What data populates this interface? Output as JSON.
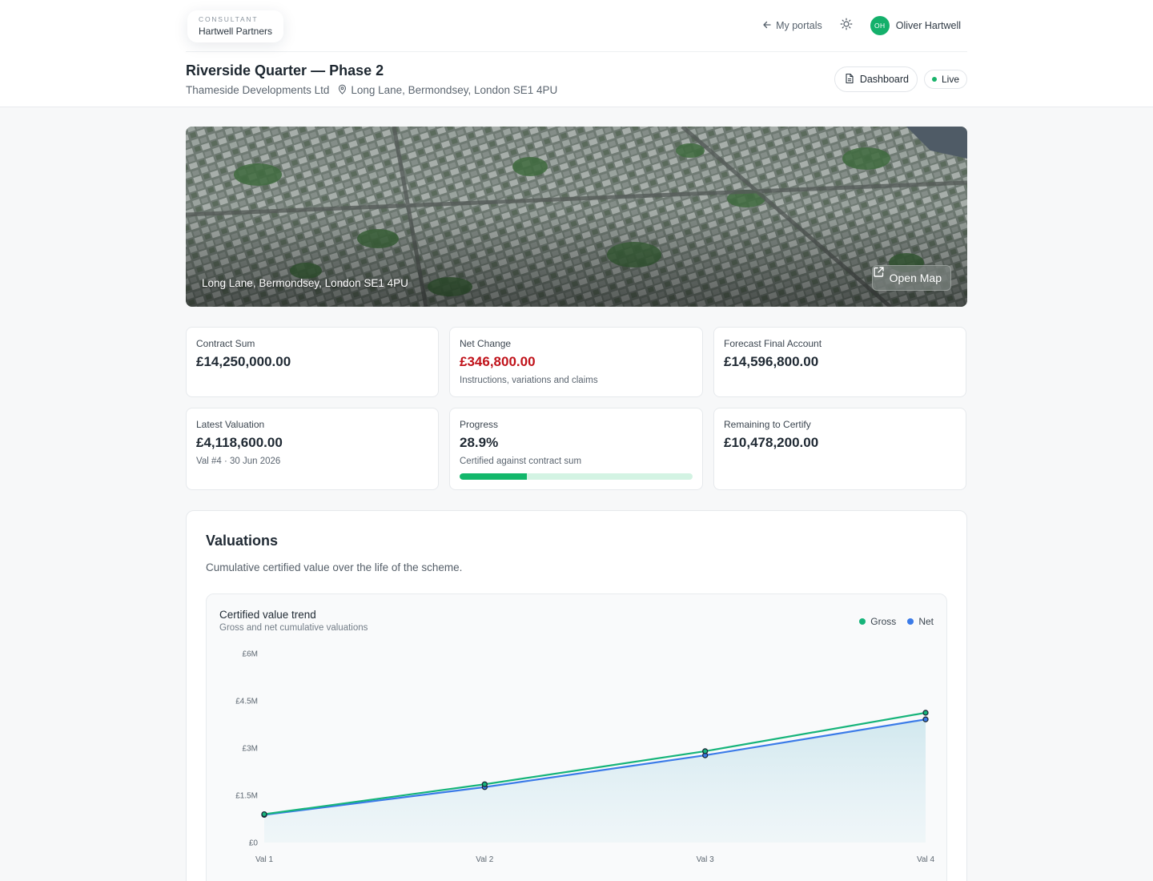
{
  "header": {
    "brand_kicker": "CONSULTANT",
    "brand_name": "Hartwell Partners",
    "portals_label": "My portals",
    "user_initials": "OH",
    "user_name": "Oliver Hartwell"
  },
  "project": {
    "title": "Riverside Quarter — Phase 2",
    "client": "Thameside Developments Ltd",
    "address": "Long Lane, Bermondsey, London SE1 4PU",
    "dashboard_label": "Dashboard",
    "status_label": "Live"
  },
  "hero": {
    "caption": "Long Lane, Bermondsey, London SE1 4PU",
    "open_map_label": "Open Map"
  },
  "cards": {
    "contract_sum": {
      "label": "Contract Sum",
      "value": "£14,250,000.00"
    },
    "net_change": {
      "label": "Net Change",
      "value": "£346,800.00",
      "sub": "Instructions, variations and claims"
    },
    "forecast": {
      "label": "Forecast Final Account",
      "value": "£14,596,800.00"
    },
    "latest_valuation": {
      "label": "Latest Valuation",
      "value": "£4,118,600.00",
      "sub": "Val #4 · 30 Jun 2026"
    },
    "progress": {
      "label": "Progress",
      "value": "28.9%",
      "sub": "Certified against contract sum",
      "fraction": 0.289
    },
    "remaining": {
      "label": "Remaining to Certify",
      "value": "£10,478,200.00"
    }
  },
  "colors": {
    "gross": "#16b47a",
    "net": "#3b7be8",
    "negative": "#c0121a",
    "accent": "#12b76b"
  },
  "valuations": {
    "title": "Valuations",
    "description": "Cumulative certified value over the life of the scheme."
  },
  "chart_data": {
    "type": "line",
    "title": "Certified value trend",
    "subtitle": "Gross and net cumulative valuations",
    "categories": [
      "Val 1",
      "Val 2",
      "Val 3",
      "Val 4"
    ],
    "series": [
      {
        "name": "Gross",
        "values": [
          900000,
          1850000,
          2900000,
          4120000
        ]
      },
      {
        "name": "Net",
        "values": [
          880000,
          1760000,
          2770000,
          3910000
        ]
      }
    ],
    "y_ticks": [
      "£0",
      "£1.5M",
      "£3M",
      "£4.5M",
      "£6M"
    ],
    "y_tick_values": [
      0,
      1500000,
      3000000,
      4500000,
      6000000
    ],
    "ylim": [
      0,
      6000000
    ],
    "legend_position": "top-right",
    "grid": false
  }
}
